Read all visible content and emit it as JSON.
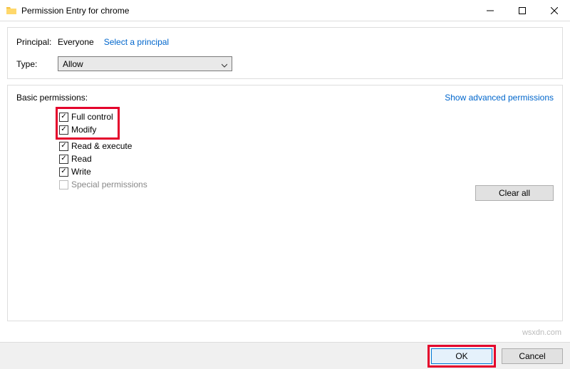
{
  "window": {
    "title": "Permission Entry for chrome"
  },
  "top_panel": {
    "principal_label": "Principal:",
    "principal_value": "Everyone",
    "select_principal_link": "Select a principal",
    "type_label": "Type:",
    "type_value": "Allow"
  },
  "permissions_panel": {
    "basic_label": "Basic permissions:",
    "advanced_link": "Show advanced permissions",
    "items": [
      {
        "label": "Full control",
        "checked": true,
        "highlighted": true,
        "disabled": false
      },
      {
        "label": "Modify",
        "checked": true,
        "highlighted": true,
        "disabled": false
      },
      {
        "label": "Read & execute",
        "checked": true,
        "highlighted": false,
        "disabled": false
      },
      {
        "label": "Read",
        "checked": true,
        "highlighted": false,
        "disabled": false
      },
      {
        "label": "Write",
        "checked": true,
        "highlighted": false,
        "disabled": false
      },
      {
        "label": "Special permissions",
        "checked": false,
        "highlighted": false,
        "disabled": true
      }
    ],
    "clear_all": "Clear all"
  },
  "footer": {
    "ok": "OK",
    "cancel": "Cancel"
  },
  "watermark": "wsxdn.com"
}
